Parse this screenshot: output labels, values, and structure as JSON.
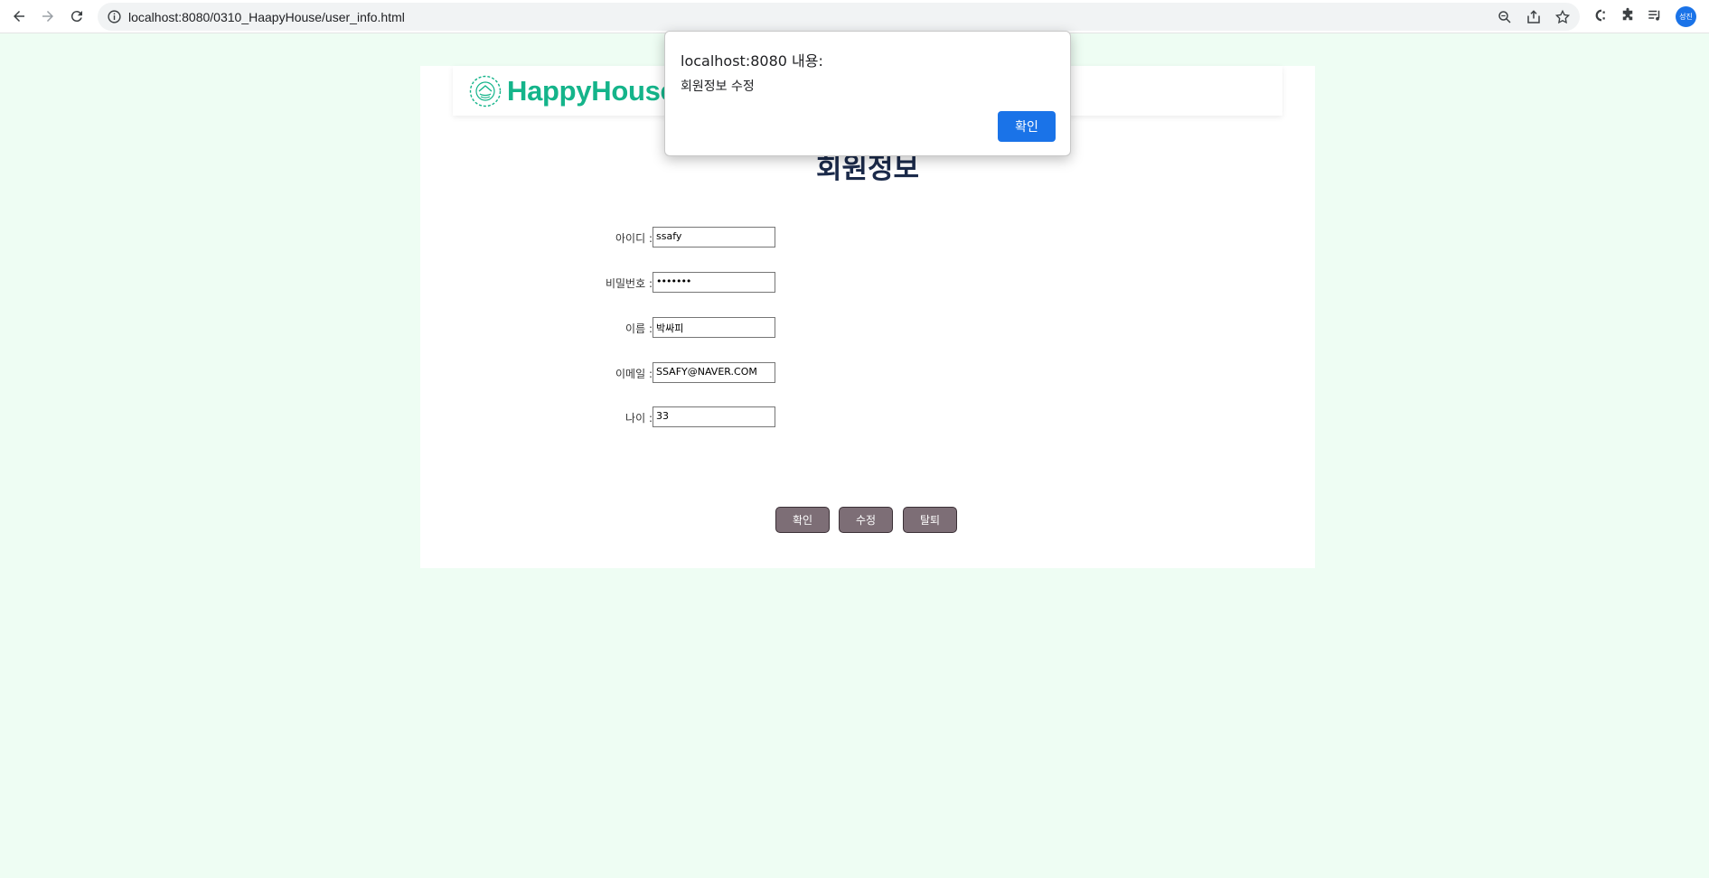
{
  "browser": {
    "url": "localhost:8080/0310_HaapyHouse/user_info.html",
    "avatar_text": "성진"
  },
  "site": {
    "logo_text": "HappyHouse"
  },
  "page": {
    "title": "회원정보"
  },
  "form": {
    "fields": [
      {
        "label": "아이디 :",
        "value": "ssafy"
      },
      {
        "label": "비밀번호 :",
        "value": "•••••••"
      },
      {
        "label": "이름 :",
        "value": "박싸피"
      },
      {
        "label": "이메일 :",
        "value": "SSAFY@NAVER.COM"
      },
      {
        "label": "나이 :",
        "value": "33"
      }
    ]
  },
  "buttons": {
    "confirm": "확인",
    "edit": "수정",
    "withdraw": "탈퇴"
  },
  "alert": {
    "title": "localhost:8080 내용:",
    "message": "회원정보 수정",
    "ok_label": "확인"
  },
  "colors": {
    "page_bg": "#eefdf3",
    "logo": "#14b48a",
    "button_bg": "#7d6e76",
    "alert_button": "#1a73e8"
  }
}
